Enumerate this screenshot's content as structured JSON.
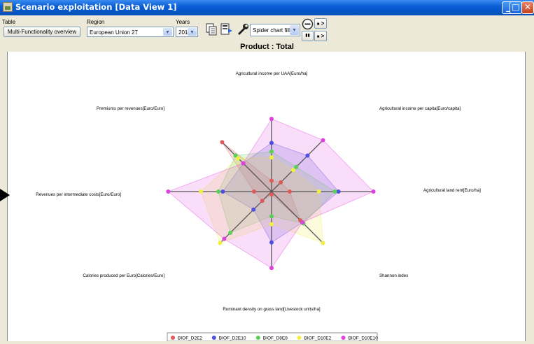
{
  "window": {
    "title": "Scenario exploitation [Data View 1]",
    "minimize_glyph": "_",
    "maximize_glyph": "□",
    "close_glyph": "✕"
  },
  "toolbar": {
    "table_label": "Table",
    "table_button": "Multi-Functionality overview",
    "region_label": "Region",
    "region_value": "European Union 27",
    "years_label": "Years",
    "years_value": "2013",
    "chart_type_value": "Spider chart filled",
    "icons": [
      "copy-icon",
      "export-icon",
      "wrench-icon",
      "zoom-out-icon",
      "play-forward-icon",
      "play-back-icon"
    ],
    "play_glyph": ">"
  },
  "chart_data": {
    "type": "radar",
    "title": "Product : Total",
    "axes": [
      "Agricultural income per UAA[Euro/ha]",
      "Agricultural income per capita[Euro/capita]",
      "Agricultural land rent[Euro/ha]",
      "Shannon index",
      "Ruminant density on grass land[Livestock units/ha]",
      "Calories produced per Euro[Calories/Euro]",
      "Revenues per intermediate costs[Euro/Euro]",
      "Premiums per revenues[Euro/Euro]"
    ],
    "rmax": 1.0,
    "grid": false,
    "legend_position": "bottom",
    "series": [
      {
        "name": "BIOF_D2E2",
        "color": "#e05a5a",
        "values": [
          0.15,
          0.18,
          0.25,
          0.56,
          0.04,
          0.18,
          0.24,
          0.96
        ]
      },
      {
        "name": "BIOF_D2E10",
        "color": "#5050e0",
        "values": [
          0.67,
          0.7,
          0.92,
          0.6,
          0.7,
          0.35,
          0.67,
          0.55
        ]
      },
      {
        "name": "BIOF_D8E8",
        "color": "#58d058",
        "values": [
          0.55,
          0.48,
          0.87,
          0.62,
          0.34,
          0.8,
          0.73,
          0.7
        ]
      },
      {
        "name": "BIOF_D10E2",
        "color": "#f0f040",
        "values": [
          0.47,
          0.42,
          0.65,
          1.0,
          0.45,
          1.0,
          0.97,
          0.65
        ]
      },
      {
        "name": "BIOF_D10E10",
        "color": "#e040e0",
        "values": [
          1.0,
          1.0,
          1.4,
          0.6,
          1.05,
          0.92,
          1.42,
          0.55
        ]
      }
    ]
  }
}
